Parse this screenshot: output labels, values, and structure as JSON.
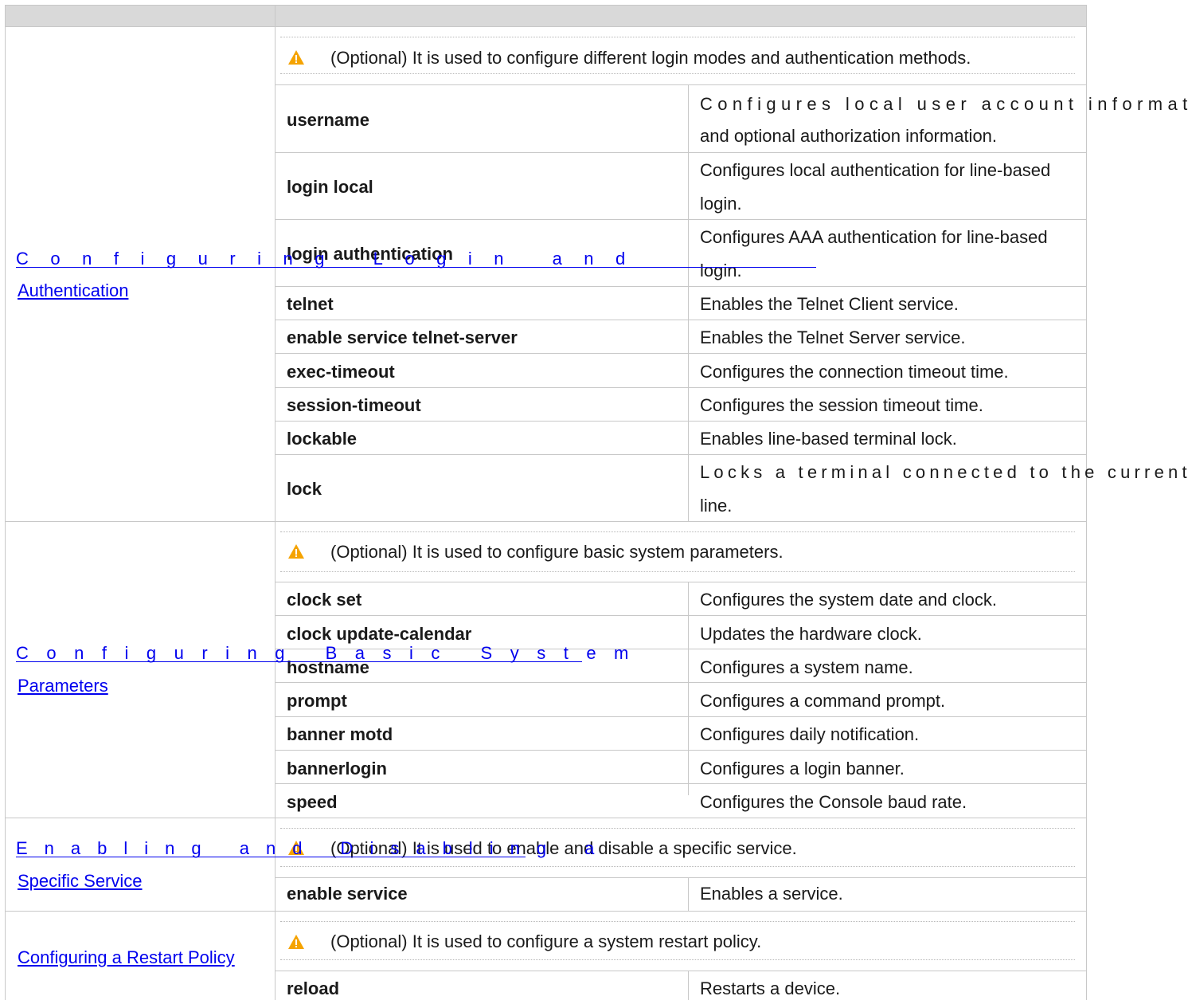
{
  "header": {
    "col1": "",
    "col2": ""
  },
  "groups": [
    {
      "link_line1": "Configuring Login and",
      "link_line2": "Authentication",
      "note": "(Optional) It is used to configure different login modes and authentication methods.",
      "rows": [
        {
          "cmd": "username",
          "desc1": "Configures local user account information",
          "desc2": "and optional authorization information."
        },
        {
          "cmd": "login local",
          "desc1": "Configures local authentication for line-based",
          "desc2": "login."
        },
        {
          "cmd": "login authentication",
          "desc1": "Configures AAA authentication for line-based",
          "desc2": "login."
        },
        {
          "cmd": "telnet",
          "desc1": "Enables the Telnet Client service."
        },
        {
          "cmd": "enable service telnet-server",
          "desc1": "Enables the Telnet Server service."
        },
        {
          "cmd": "exec-timeout",
          "desc1": "Configures the connection timeout time."
        },
        {
          "cmd": "session-timeout",
          "desc1": "Configures the session timeout time."
        },
        {
          "cmd": "lockable",
          "desc1": "Enables line-based terminal lock."
        },
        {
          "cmd": "lock",
          "desc1": "Locks a terminal connected to the current",
          "desc2": "line."
        }
      ]
    },
    {
      "link_line1": "Configuring Basic System",
      "link_line2": "Parameters",
      "note": "(Optional) It is used to configure basic system parameters.",
      "rows": [
        {
          "cmd": "clock set",
          "desc1": "Configures the system date and clock."
        },
        {
          "cmd": "clock update-calendar",
          "desc1": "Updates the hardware clock."
        },
        {
          "cmd": "hostname",
          "desc1": "Configures a system name."
        },
        {
          "cmd": "prompt",
          "desc1": "Configures a command prompt."
        },
        {
          "cmd": "banner motd",
          "desc1": "Configures daily notification."
        },
        {
          "cmd": "bannerlogin",
          "desc1": "Configures a login banner."
        },
        {
          "cmd": "speed",
          "desc1": "Configures the Console baud rate."
        }
      ]
    },
    {
      "link_line1": "Enabling and Disabling a",
      "link_line2": "Specific Service",
      "note": "(Optional) It is used to enable and disable a specific service.",
      "rows": [
        {
          "cmd": "enable service",
          "desc1": "Enables a service."
        }
      ]
    },
    {
      "link_line1": "Configuring a Restart Policy",
      "note": "(Optional) It is used to configure a system restart policy.",
      "rows": [
        {
          "cmd": "reload",
          "desc1": "Restarts a device."
        }
      ]
    }
  ],
  "colors": {
    "link": "#0000ee",
    "warning": "#f5a300",
    "header_bg": "#d9d9d9",
    "grid": "#c8c8c8"
  },
  "icons": {
    "warning": "warning-triangle-icon"
  }
}
